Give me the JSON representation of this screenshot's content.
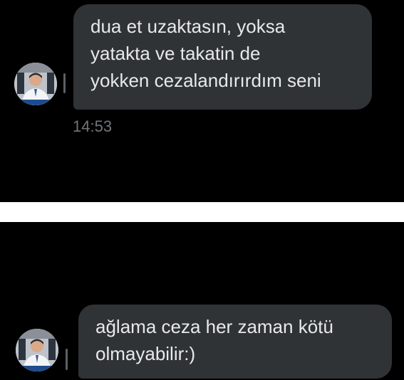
{
  "messages": [
    {
      "text": "dua et uzaktasın, yoksa\nyatakta ve takatin de\nyokken cezalandırırdım seni",
      "time": "14:53"
    },
    {
      "text": "ağlama ceza her zaman kötü\nolmayabilir:)"
    }
  ],
  "colors": {
    "background": "#000000",
    "bubble": "#2f3336",
    "bubble_text": "#e7e9ea",
    "timestamp": "#71767b",
    "separator": "#ffffff"
  },
  "icons": {
    "avatar": "user-avatar-photo"
  }
}
